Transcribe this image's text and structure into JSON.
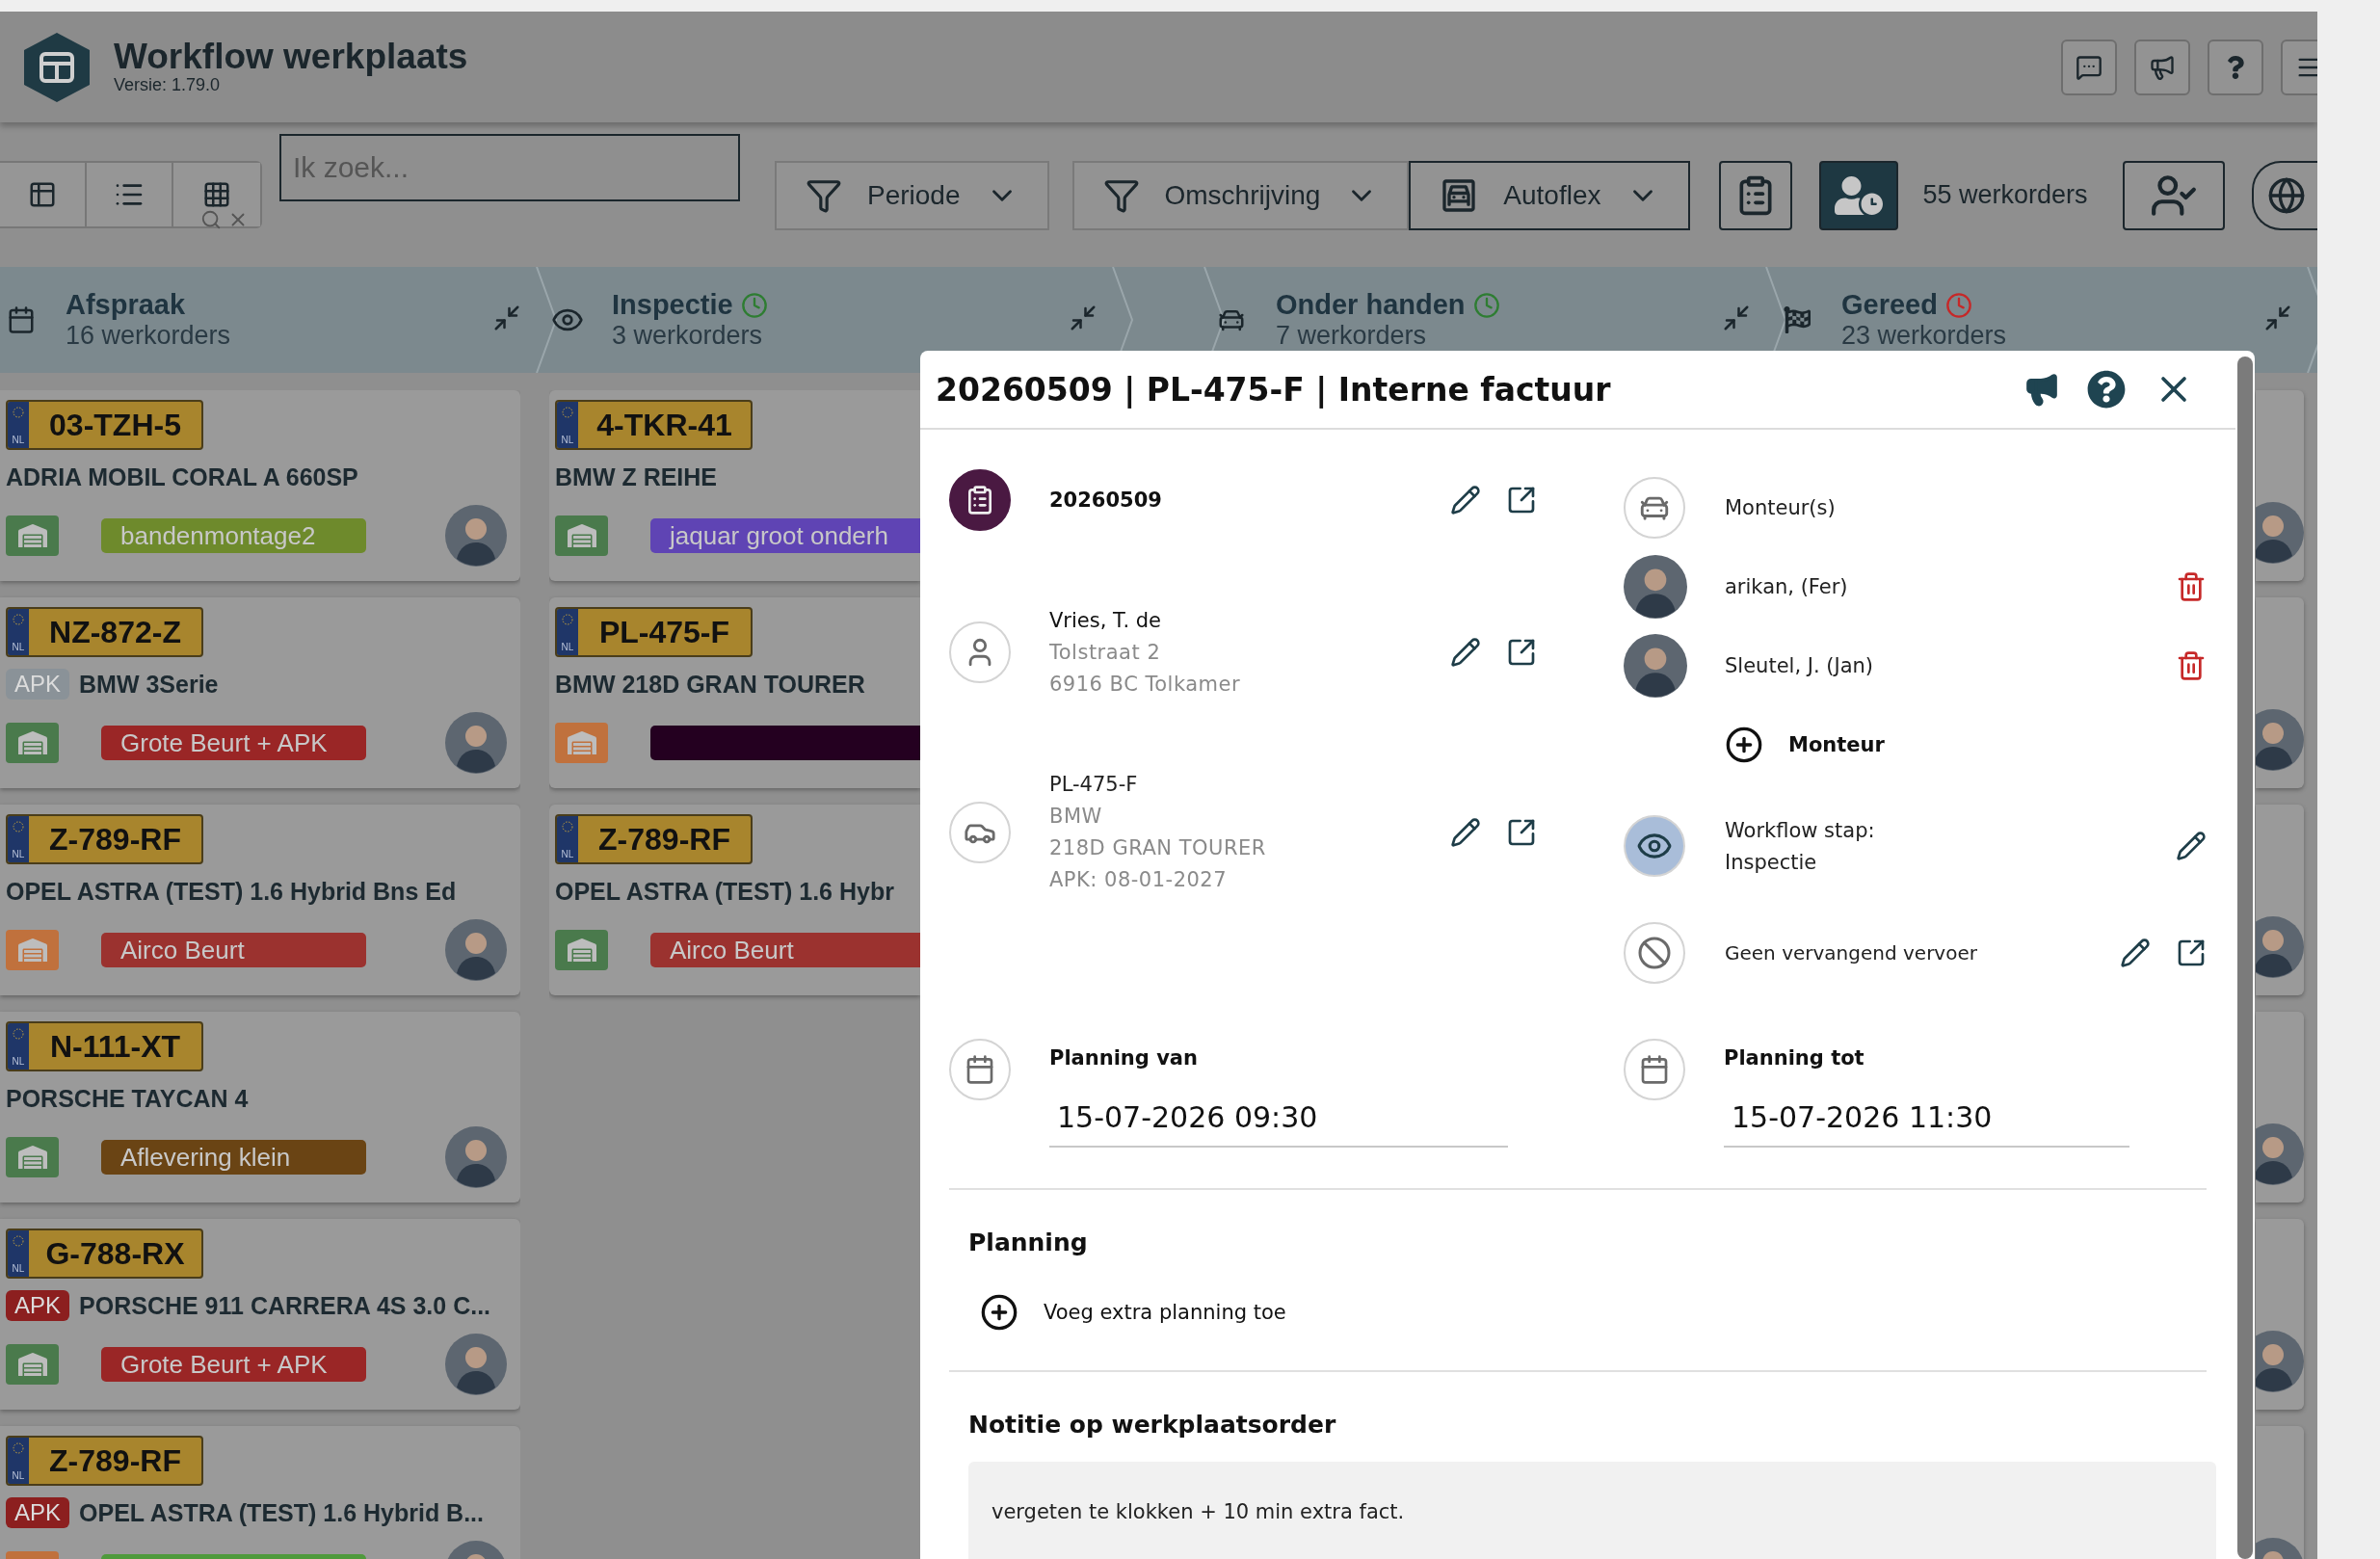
{
  "app": {
    "title": "Workflow werkplaats",
    "version": "Versie: 1.79.0"
  },
  "toolbar": {
    "search": {
      "placeholder": "Ik zoek..."
    },
    "filters": [
      {
        "label": "Periode",
        "kind": "funnel"
      },
      {
        "label": "Omschrijving",
        "kind": "funnel"
      },
      {
        "label": "Autoflex",
        "kind": "garage"
      }
    ],
    "count": "55 werkorders"
  },
  "columns": [
    {
      "title": "Afspraak",
      "count": "16 werkorders"
    },
    {
      "title": "Inspectie",
      "count": "3 werkorders",
      "color": "#2e7d32"
    },
    {
      "title": "Onder handen",
      "count": "7 werkorders",
      "color": "#2e7d32"
    },
    {
      "title": "Gereed",
      "count": "23 werkorders",
      "color": "#c62828"
    }
  ],
  "cards": [
    [
      {
        "plate": "03-TZH-5",
        "country": "NL",
        "model": "ADRIA MOBIL CORAL A 660SP",
        "garage": {
          "color": "#4a7a4c"
        },
        "tag": {
          "label": "bandenmontage2",
          "color": "#6e8a2c"
        },
        "avatar": true
      },
      {
        "plate": "NZ-872-Z",
        "country": "NL",
        "apk": {
          "label": "APK",
          "color": "#8a9298"
        },
        "model": "BMW 3Serie",
        "garage": {
          "color": "#4a7a4c"
        },
        "tag": {
          "label": "Grote Beurt + APK",
          "color": "#9a2626"
        },
        "avatar": true
      },
      {
        "plate": "Z-789-RF",
        "country": "NL",
        "model": "OPEL ASTRA (TEST) 1.6 Hybrid Bns Ed",
        "garage": {
          "color": "#c0713d"
        },
        "tag": {
          "label": "Airco Beurt",
          "color": "#9b322f"
        },
        "avatar": true
      },
      {
        "plate": "N-111-XT",
        "country": "NL",
        "model": "PORSCHE TAYCAN 4",
        "garage": {
          "color": "#4a7a4c"
        },
        "tag": {
          "label": "Aflevering klein",
          "color": "#6a4414"
        },
        "avatar": true
      },
      {
        "plate": "G-788-RX",
        "country": "NL",
        "apk": {
          "label": "APK",
          "color": "#8c1f1f"
        },
        "model": "PORSCHE 911 CARRERA 4S 3.0 C...",
        "garage": {
          "color": "#4a7a4c"
        },
        "tag": {
          "label": "Grote Beurt + APK",
          "color": "#9a2626"
        },
        "avatar": true
      },
      {
        "plate": "Z-789-RF",
        "country": "NL",
        "apk": {
          "label": "APK",
          "color": "#8c1f1f"
        },
        "model": "OPEL ASTRA (TEST) 1.6 Hybrid B...",
        "garage": {
          "color": "#c0713d"
        },
        "tag": {
          "color": "#4f9a3c"
        },
        "avatar": true
      }
    ],
    [
      {
        "plate": "4-TKR-41",
        "country": "NL",
        "model": "BMW Z REIHE",
        "garage": {
          "color": "#4a7a4c"
        },
        "tag": {
          "label": "jaquar groot onderh",
          "color": "#5f44b4"
        }
      },
      {
        "plate": "PL-475-F",
        "country": "NL",
        "model": "BMW 218D GRAN TOURER",
        "garage": {
          "color": "#c0713d"
        },
        "tag": {
          "color": "#240020"
        }
      },
      {
        "plate": "Z-789-RF",
        "country": "NL",
        "model": "OPEL ASTRA (TEST) 1.6 Hybr",
        "garage": {
          "color": "#4a7a4c"
        },
        "tag": {
          "label": "Airco Beurt",
          "color": "#9b322f"
        }
      }
    ]
  ],
  "modal": {
    "title": "20260509 | PL-475-F | Interne factuur",
    "order": {
      "number": "20260509"
    },
    "customer": {
      "name": "Vries, T. de",
      "lines": [
        "Tolstraat 2",
        "6916 BC Tolkamer"
      ]
    },
    "vehicle": {
      "plate": "PL-475-F",
      "lines": [
        "BMW",
        "218D GRAN TOURER",
        "APK: 08-01-2027"
      ]
    },
    "mechanics": {
      "heading": "Monteur(s)",
      "people": [
        {
          "name": "arikan, (Fer)"
        },
        {
          "name": "Sleutel, J. (Jan)"
        }
      ],
      "add_label": "Monteur"
    },
    "workflow": {
      "label": "Workflow stap:",
      "value": "Inspectie"
    },
    "transport": {
      "label": "Geen vervangend vervoer"
    },
    "planning_from": {
      "label": "Planning van",
      "value": "15-07-2026 09:30"
    },
    "planning_to": {
      "label": "Planning tot",
      "value": "15-07-2026 11:30"
    },
    "planning": {
      "heading": "Planning",
      "add_label": "Voeg extra planning toe"
    },
    "note": {
      "heading": "Notitie op werkplaatsorder",
      "text": "vergeten te klokken + 10 min extra fact."
    }
  }
}
